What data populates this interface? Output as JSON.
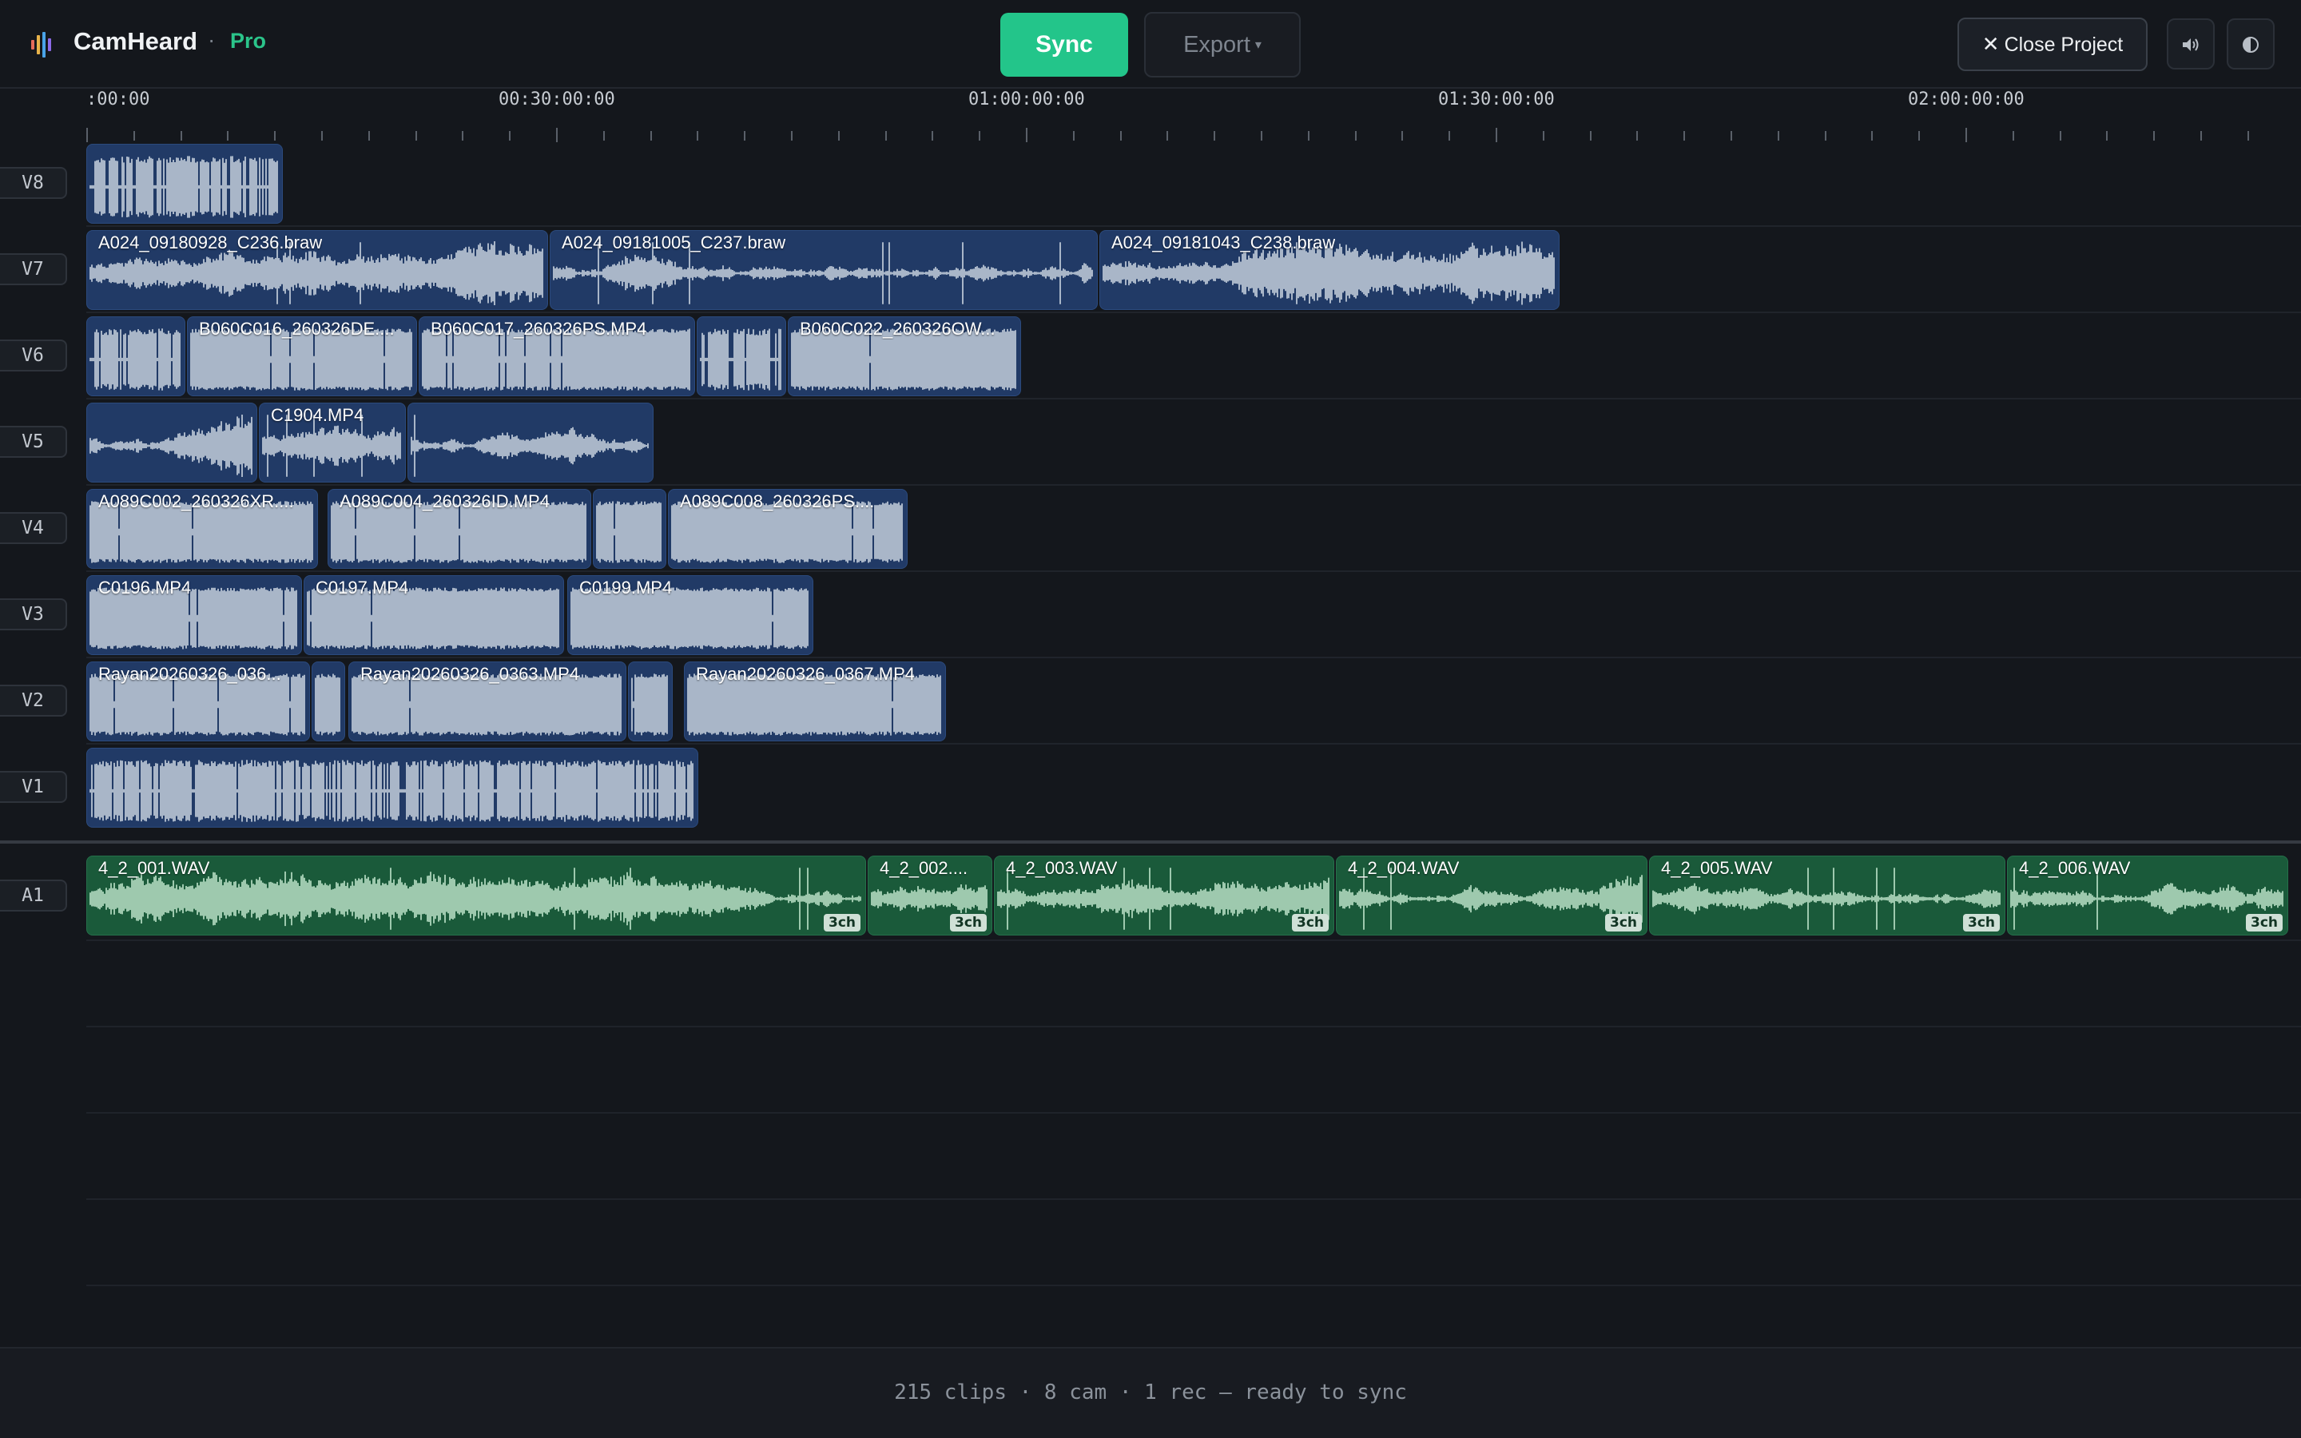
{
  "app": {
    "name": "CamHeard",
    "separator": "·",
    "tier": "Pro"
  },
  "toolbar": {
    "sync_label": "Sync",
    "export_label": "Export",
    "export_caret": "▾",
    "close_label": "Close Project",
    "close_icon": "✕",
    "volume_icon": "🔊",
    "theme_icon": "◐"
  },
  "ruler": {
    "labels": [
      ":00:00",
      "00:30:00:00",
      "01:00:00:00",
      "01:30:00:00",
      "02:00:00:00"
    ]
  },
  "tracks": [
    {
      "id": "V8",
      "clips": [
        {
          "label": ""
        }
      ]
    },
    {
      "id": "V7",
      "clips": [
        {
          "label": "A024_09180928_C236.braw"
        },
        {
          "label": "A024_09181005_C237.braw"
        },
        {
          "label": "A024_09181043_C238.braw"
        }
      ]
    },
    {
      "id": "V6",
      "clips": [
        {
          "label": ""
        },
        {
          "label": "B060C016_260326DE...."
        },
        {
          "label": "B060C017_260326PS.MP4"
        },
        {
          "label": ""
        },
        {
          "label": "B060C022_260326OW..."
        }
      ]
    },
    {
      "id": "V5",
      "clips": [
        {
          "label": ""
        },
        {
          "label": "C1904.MP4"
        },
        {
          "label": ""
        }
      ]
    },
    {
      "id": "V4",
      "clips": [
        {
          "label": "A089C002_260326XR...."
        },
        {
          "label": "A089C004_260326ID.MP4"
        },
        {
          "label": ""
        },
        {
          "label": "A089C008_260326PS...."
        }
      ]
    },
    {
      "id": "V3",
      "clips": [
        {
          "label": "C0196.MP4"
        },
        {
          "label": "C0197.MP4"
        },
        {
          "label": "C0199.MP4"
        }
      ]
    },
    {
      "id": "V2",
      "clips": [
        {
          "label": "Rayan20260326_036..."
        },
        {
          "label": ""
        },
        {
          "label": "Rayan20260326_0363.MP4"
        },
        {
          "label": ""
        },
        {
          "label": "Rayan20260326_0367.MP4"
        }
      ]
    },
    {
      "id": "V1",
      "clips": [
        {
          "label": ""
        }
      ]
    }
  ],
  "audio_tracks": [
    {
      "id": "A1",
      "clips": [
        {
          "label": "4_2_001.WAV",
          "channels": "3ch"
        },
        {
          "label": "4_2_002....",
          "channels": "3ch"
        },
        {
          "label": "4_2_003.WAV",
          "channels": "3ch"
        },
        {
          "label": "4_2_004.WAV",
          "channels": "3ch"
        },
        {
          "label": "4_2_005.WAV",
          "channels": "3ch"
        },
        {
          "label": "4_2_006.WAV",
          "channels": "3ch"
        }
      ]
    }
  ],
  "status": {
    "text": "215 clips · 8 cam · 1 rec — ready to sync"
  },
  "colors": {
    "accent": "#23c58a",
    "video_clip": "#213a66",
    "audio_clip": "#1a5a3a",
    "waveform_video": "#a9b6c8",
    "waveform_audio": "#9ec9ae"
  }
}
